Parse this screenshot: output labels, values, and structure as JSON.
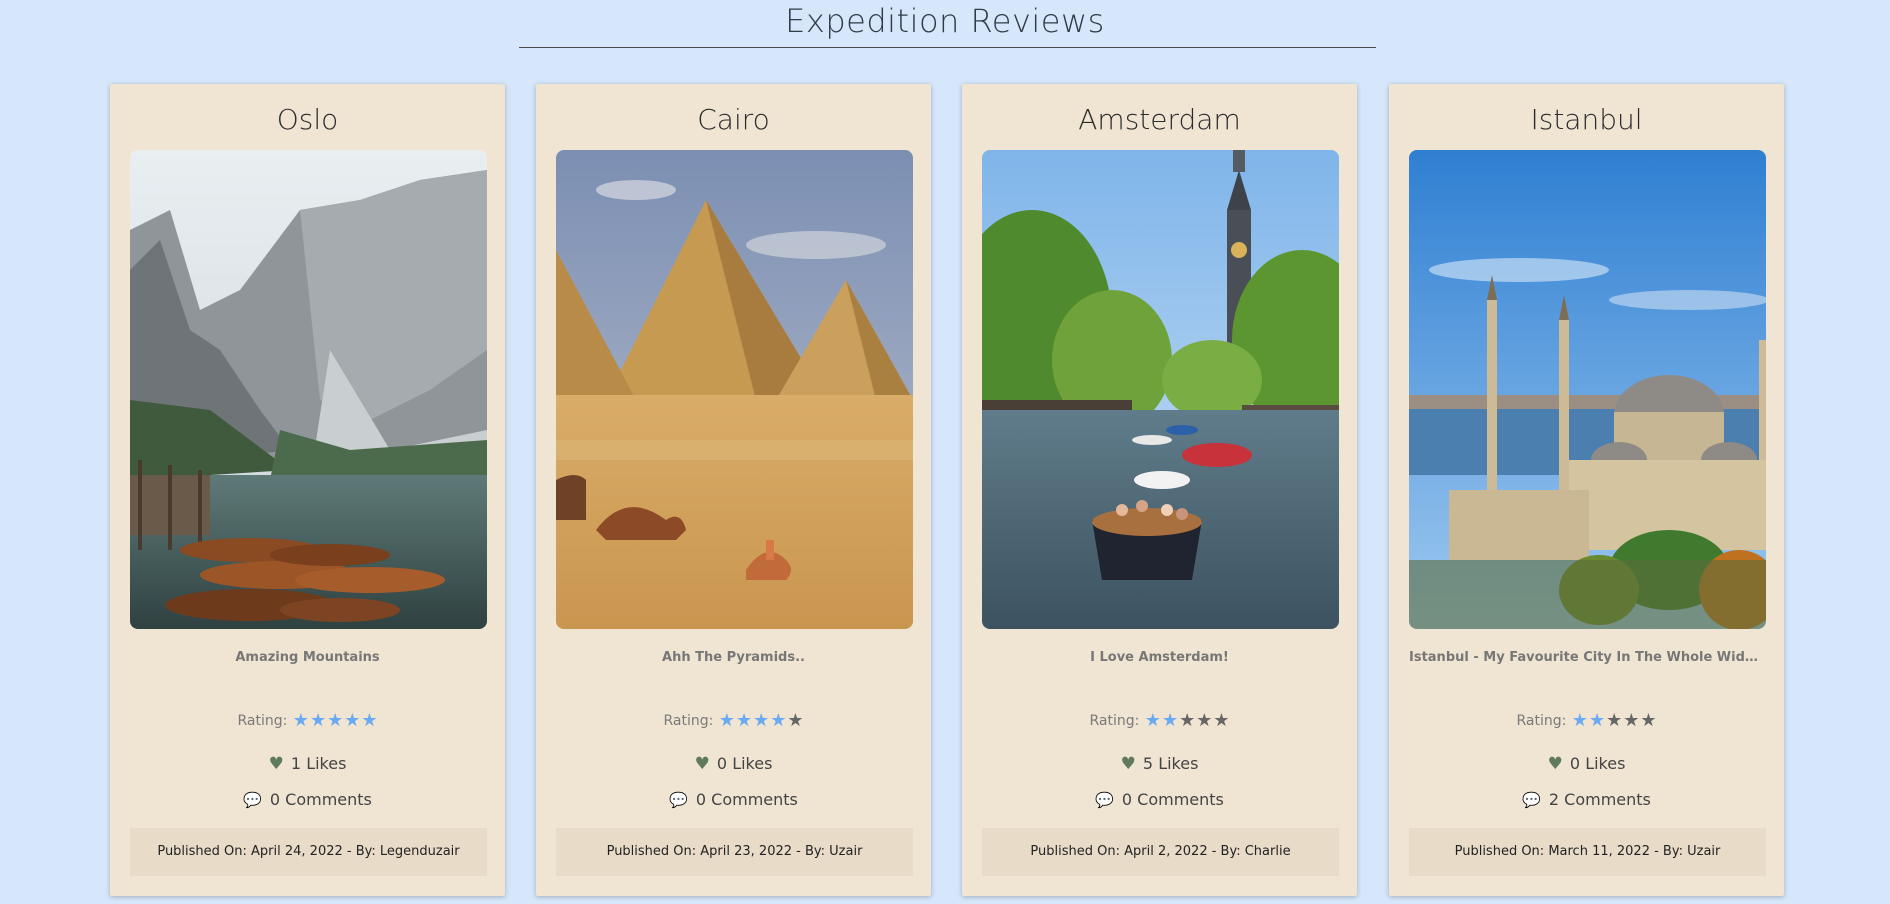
{
  "page": {
    "title": "Expedition Reviews"
  },
  "colors": {
    "background": "#d6e6fb",
    "card": "#f0e4d2",
    "star_on": "#6aaaf3",
    "star_off": "#666666",
    "heart": "#5f7a5c",
    "comment": "#c9564a"
  },
  "cards": [
    {
      "title": "Oslo",
      "caption": "Amazing Mountains",
      "rating_label": "Rating:",
      "rating": 5,
      "likes": "1 Likes",
      "comments": "0 Comments",
      "footer": "Published On: April 24, 2022 - By: Legenduzair",
      "image": "mountain-lake-boats-photo"
    },
    {
      "title": "Cairo",
      "caption": "Ahh The Pyramids..",
      "rating_label": "Rating:",
      "rating": 4,
      "likes": "0 Likes",
      "comments": "0 Comments",
      "footer": "Published On: April 23, 2022 - By: Uzair",
      "image": "pyramids-desert-camels-photo"
    },
    {
      "title": "Amsterdam",
      "caption": "I Love Amsterdam!",
      "rating_label": "Rating:",
      "rating": 2,
      "likes": "5 Likes",
      "comments": "0 Comments",
      "footer": "Published On: April 2, 2022 - By: Charlie",
      "image": "canal-boats-tower-photo"
    },
    {
      "title": "Istanbul",
      "caption": "Istanbul - My Favourite City In The Whole Wide World",
      "rating_label": "Rating:",
      "rating": 2,
      "likes": "0 Likes",
      "comments": "2 Comments",
      "footer": "Published On: March 11, 2022 - By: Uzair",
      "image": "mosque-minarets-photo"
    }
  ]
}
